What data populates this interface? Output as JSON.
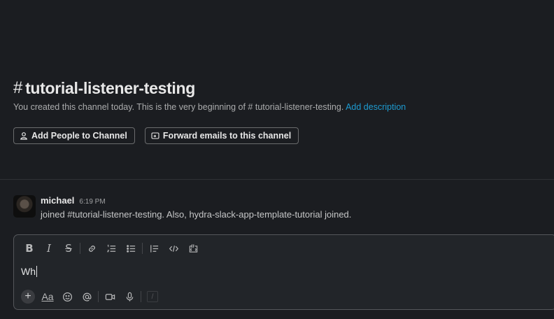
{
  "channel": {
    "hash": "#",
    "name": "tutorial-listener-testing",
    "description_prefix": "You created this channel today. This is the very beginning of",
    "description_channel": "# tutorial-listener-testing.",
    "add_description_link": "Add description"
  },
  "intro_buttons": {
    "add_people": "Add People to Channel",
    "forward_emails": "Forward emails to this channel"
  },
  "message": {
    "author": "michael",
    "time": "6:19 PM",
    "text": "joined #tutorial-listener-testing. Also, hydra-slack-app-template-tutorial joined."
  },
  "composer": {
    "value": "Wh",
    "formatting": {
      "bold": "B",
      "italic": "I",
      "strike": "S"
    },
    "bottom": {
      "plus": "+",
      "text_format": "Aa",
      "slash": "/"
    }
  },
  "colors": {
    "background": "#1b1d21",
    "composer_bg": "#222529",
    "link": "#1d9bd1"
  }
}
